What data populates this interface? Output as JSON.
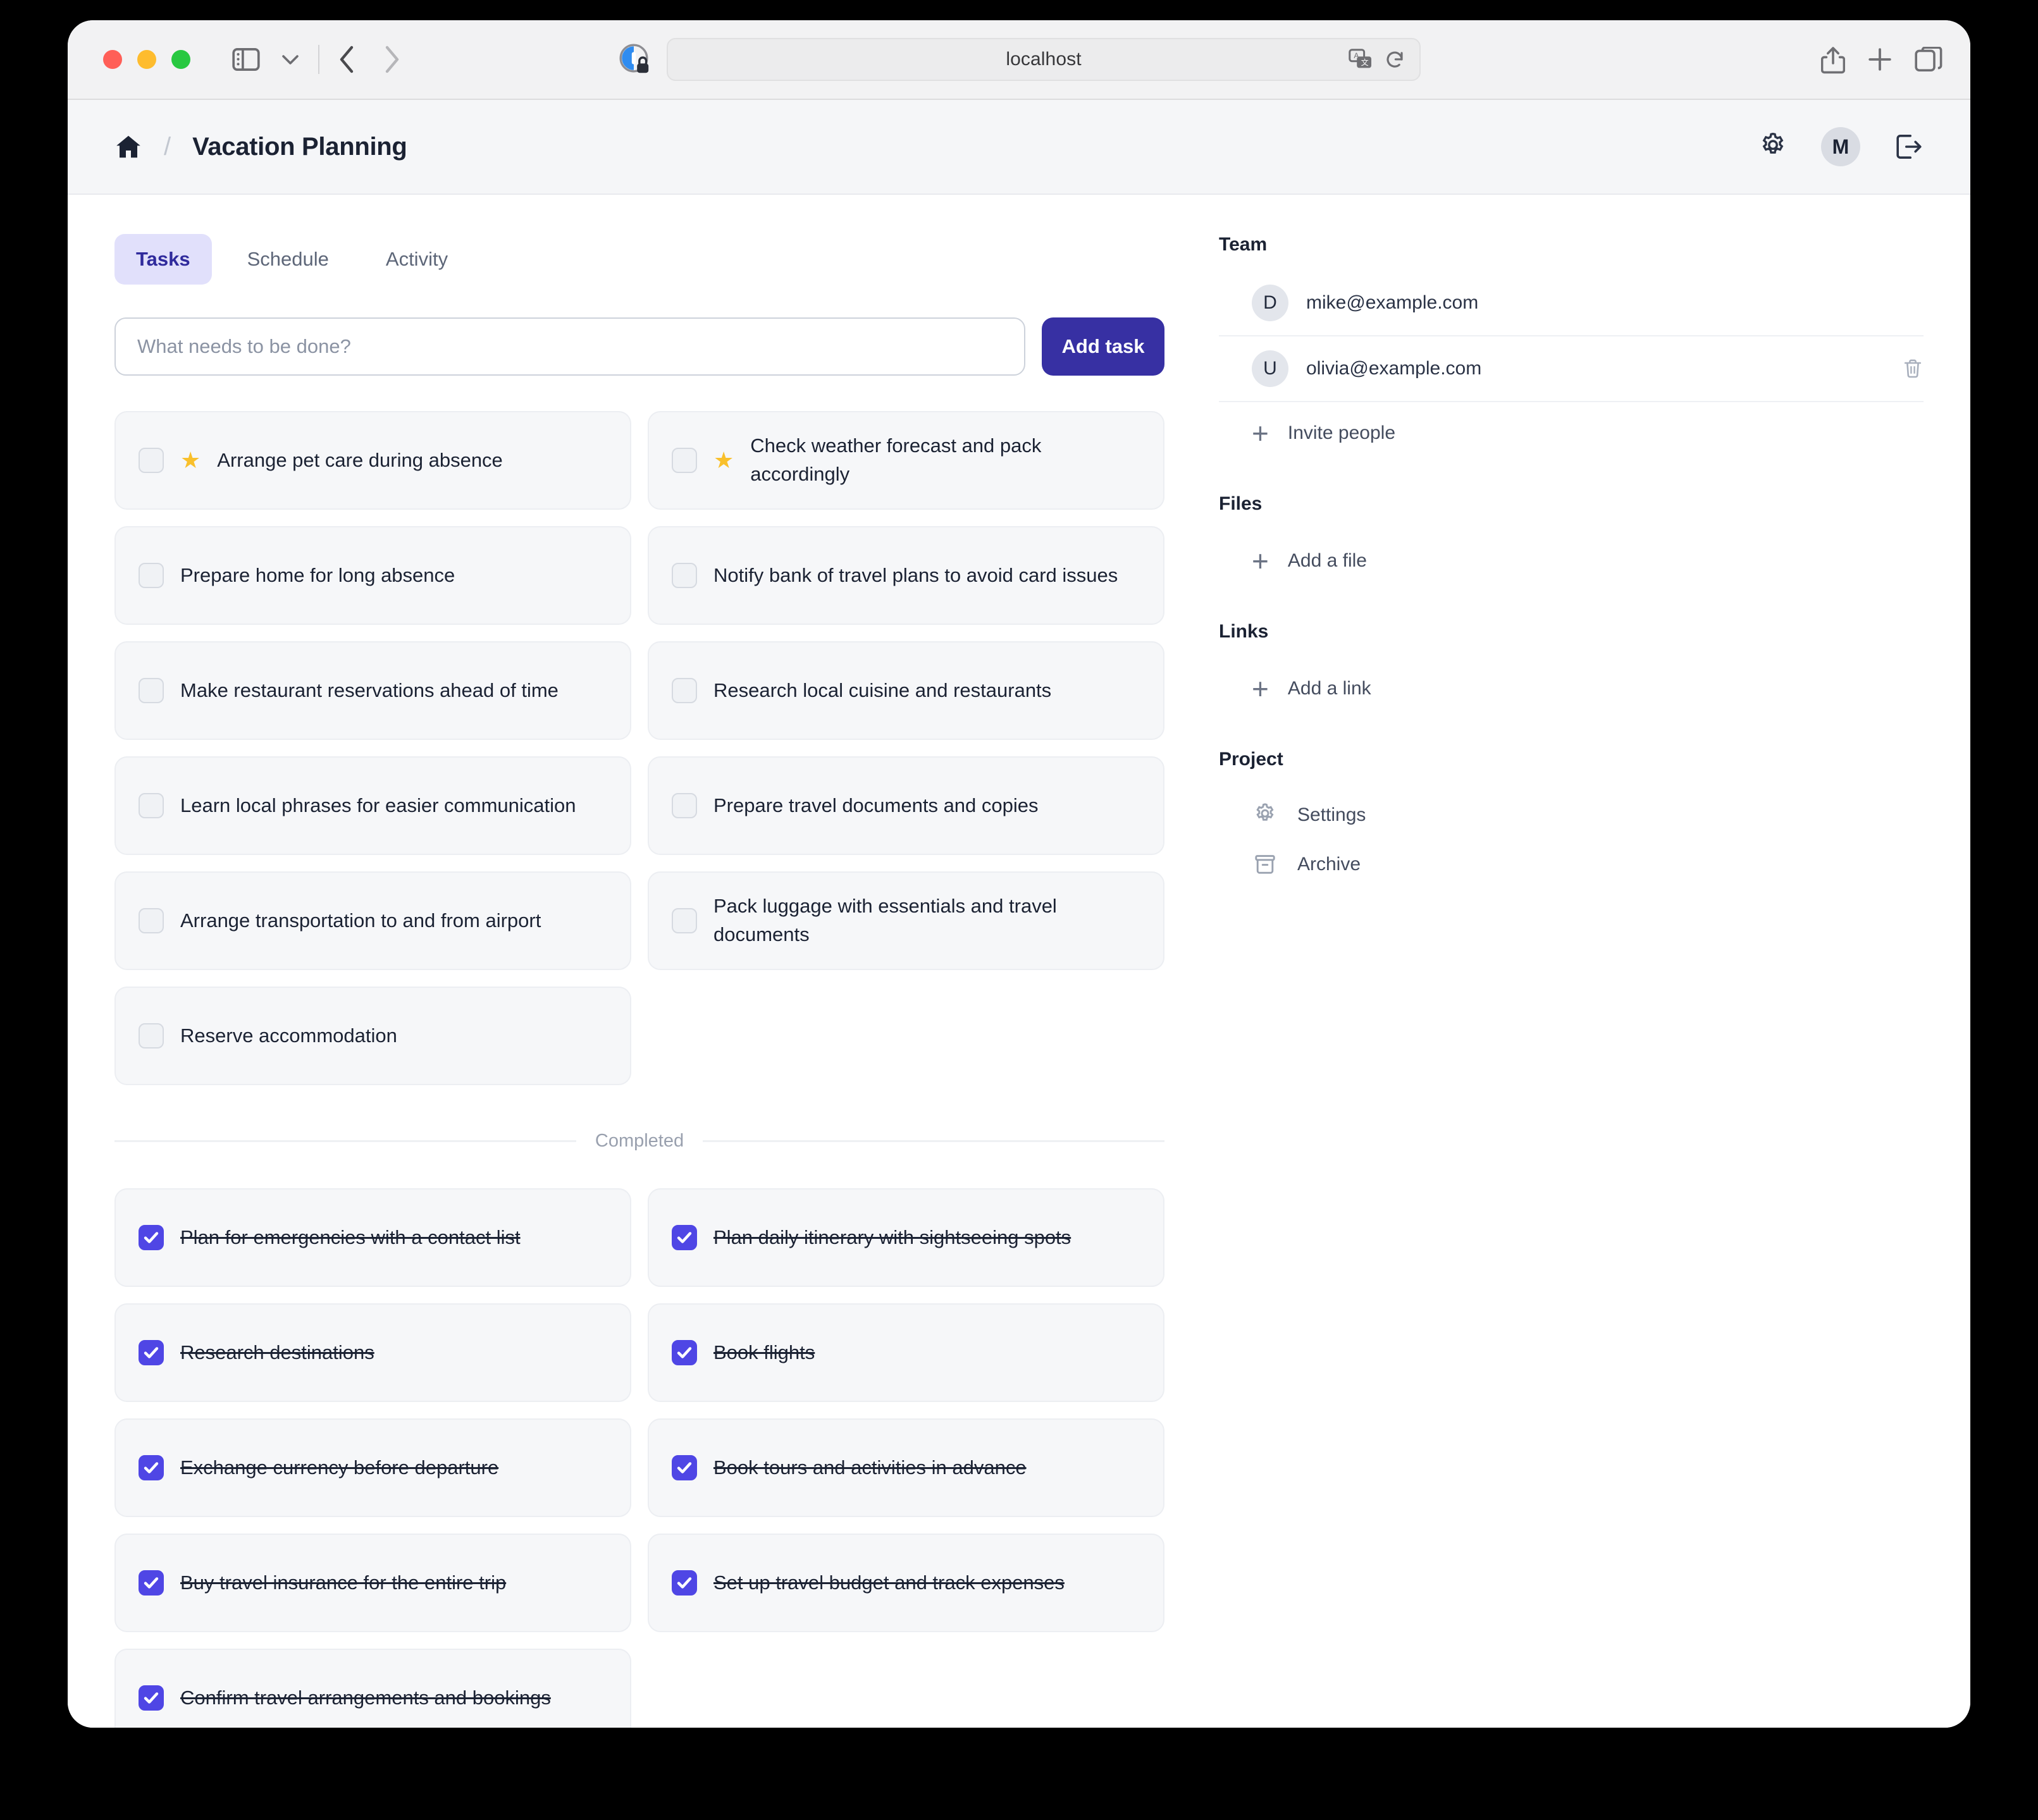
{
  "browser": {
    "url_text": "localhost",
    "traffic_lights": [
      "close-red",
      "minimize-yellow",
      "zoom-green"
    ],
    "sidebar_toggle": "sidebar-icon",
    "tab_overview": "tabs-icon",
    "share": "share-icon",
    "new_tab": "plus-icon",
    "reload": "reload-icon",
    "translate": "translate-icon",
    "back": "back-arrow-icon",
    "forward": "forward-arrow-icon"
  },
  "header": {
    "home_icon": "home-icon",
    "separator": "/",
    "title": "Vacation Planning",
    "settings_icon": "gear-icon",
    "avatar_initial": "M",
    "logout_icon": "logout-icon"
  },
  "tabs": [
    {
      "label": "Tasks",
      "active": true
    },
    {
      "label": "Schedule",
      "active": false
    },
    {
      "label": "Activity",
      "active": false
    }
  ],
  "composer": {
    "placeholder": "What needs to be done?",
    "value": "",
    "button_label": "Add task"
  },
  "tasks": {
    "active": [
      {
        "text": "Arrange pet care during absence",
        "starred": true
      },
      {
        "text": "Check weather forecast and pack accordingly",
        "starred": true
      },
      {
        "text": "Prepare home for long absence",
        "starred": false
      },
      {
        "text": "Notify bank of travel plans to avoid card issues",
        "starred": false
      },
      {
        "text": "Make restaurant reservations ahead of time",
        "starred": false
      },
      {
        "text": "Research local cuisine and restaurants",
        "starred": false
      },
      {
        "text": "Learn local phrases for easier communication",
        "starred": false
      },
      {
        "text": "Prepare travel documents and copies",
        "starred": false
      },
      {
        "text": "Arrange transportation to and from airport",
        "starred": false
      },
      {
        "text": "Pack luggage with essentials and travel documents",
        "starred": false
      },
      {
        "text": "Reserve accommodation",
        "starred": false
      }
    ],
    "completed_divider": "Completed",
    "completed": [
      {
        "text": "Plan for emergencies with a contact list"
      },
      {
        "text": "Plan daily itinerary with sightseeing spots"
      },
      {
        "text": "Research destinations"
      },
      {
        "text": "Book flights"
      },
      {
        "text": "Exchange currency before departure"
      },
      {
        "text": "Book tours and activities in advance"
      },
      {
        "text": "Buy travel insurance for the entire trip"
      },
      {
        "text": "Set up travel budget and track expenses"
      },
      {
        "text": "Confirm travel arrangements and bookings"
      }
    ]
  },
  "sidebar": {
    "team": {
      "heading": "Team",
      "members": [
        {
          "initial": "D",
          "email": "mike@example.com",
          "deletable": false
        },
        {
          "initial": "U",
          "email": "olivia@example.com",
          "deletable": true
        }
      ],
      "invite_label": "Invite people"
    },
    "files": {
      "heading": "Files",
      "add_label": "Add a file"
    },
    "links": {
      "heading": "Links",
      "add_label": "Add a link"
    },
    "project": {
      "heading": "Project",
      "items": [
        {
          "label": "Settings",
          "icon": "gear-icon"
        },
        {
          "label": "Archive",
          "icon": "archive-icon"
        }
      ]
    }
  },
  "colors": {
    "accent": "#4f46e5",
    "accent_dark": "#3730a3",
    "tab_active_bg": "#e1e0fb",
    "tab_active_text": "#2f2a9c",
    "star": "#f9c02c",
    "card_bg": "#f6f7f9"
  }
}
